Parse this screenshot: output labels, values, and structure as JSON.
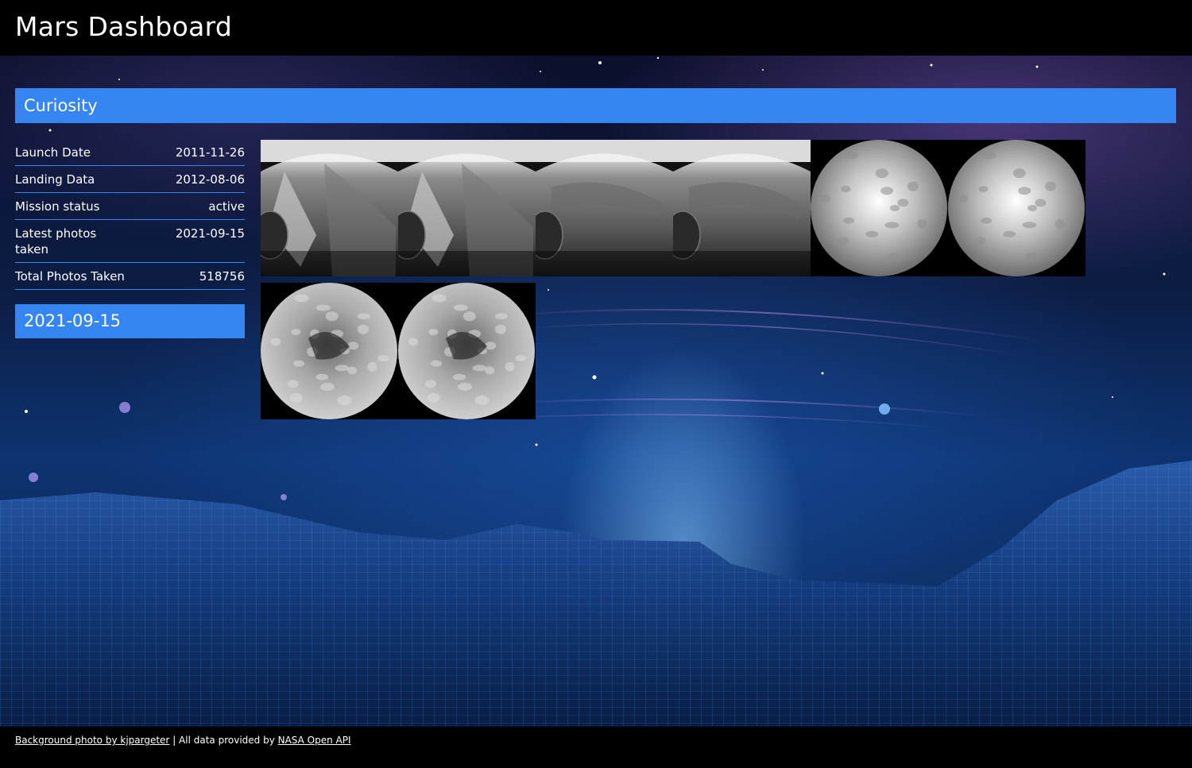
{
  "header": {
    "title": "Mars Dashboard"
  },
  "rover": {
    "name": "Curiosity",
    "info": [
      {
        "label": "Launch Date",
        "value": "2011-11-26"
      },
      {
        "label": "Landing Data",
        "value": "2012-08-06"
      },
      {
        "label": "Mission status",
        "value": "active"
      },
      {
        "label": "Latest photos taken",
        "value": "2021-09-15"
      },
      {
        "label": "Total Photos Taken",
        "value": "518756"
      }
    ],
    "selected_date": "2021-09-15"
  },
  "photos": [
    {
      "kind": "hazcam-terrain"
    },
    {
      "kind": "hazcam-terrain"
    },
    {
      "kind": "hazcam-wheel"
    },
    {
      "kind": "hazcam-wheel"
    },
    {
      "kind": "fisheye-bright"
    },
    {
      "kind": "fisheye-bright"
    },
    {
      "kind": "fisheye-rocky"
    },
    {
      "kind": "fisheye-rocky"
    }
  ],
  "footer": {
    "credit_link": "Background photo by kjpargeter",
    "separator": " | All data provided by ",
    "api_link": "NASA Open API"
  },
  "colors": {
    "accent": "#3585f3",
    "header_bg": "#000000",
    "text": "#ffffff"
  }
}
